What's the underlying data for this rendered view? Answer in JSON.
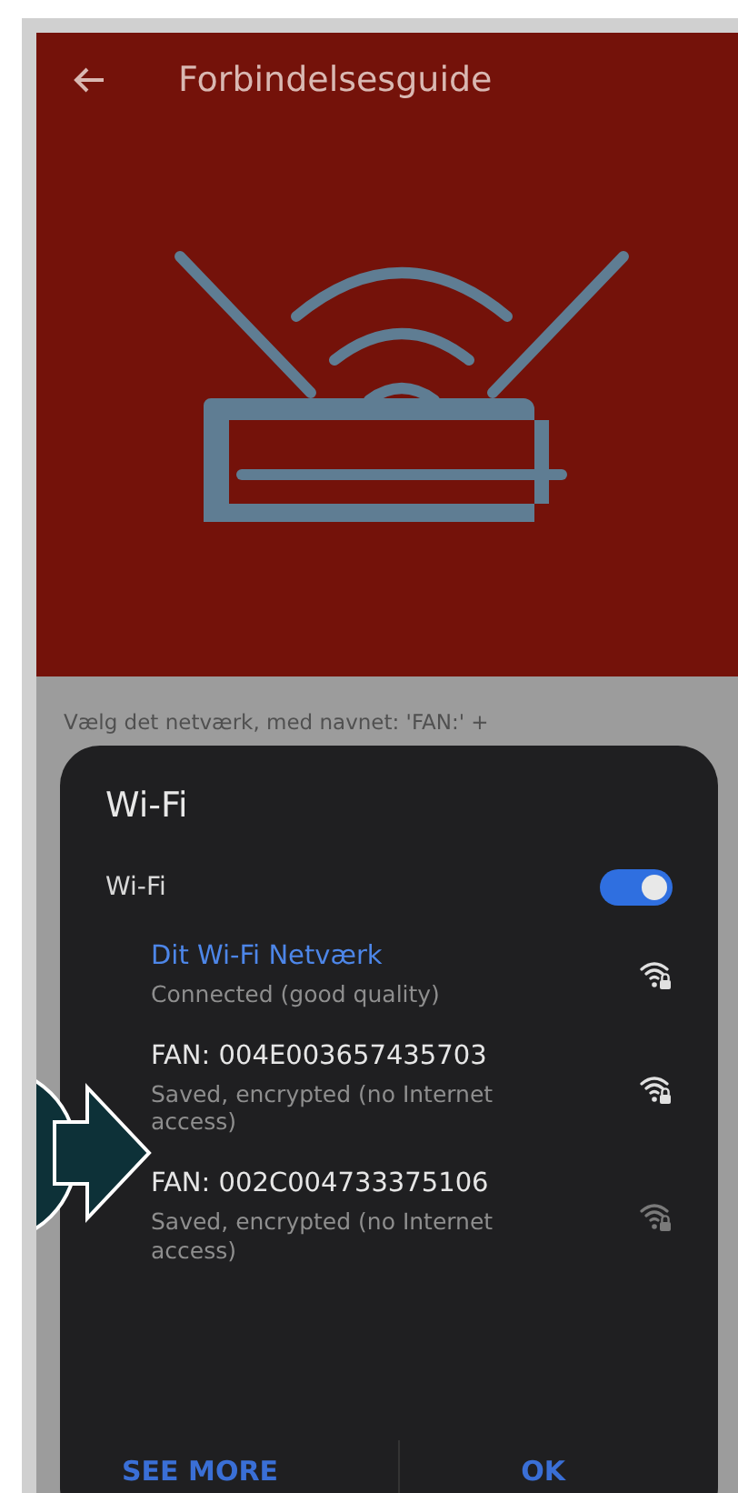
{
  "app_bar": {
    "title": "Forbindelsesguide"
  },
  "instruction": "Vælg det netværk, med navnet: 'FAN:' +",
  "dialog": {
    "title": "Wi-Fi",
    "wifi_toggle": {
      "label": "Wi-Fi",
      "on": true
    },
    "networks": [
      {
        "name": "Dit Wi-Fi Netværk",
        "status": "Connected (good quality)",
        "selected": true,
        "dimmed": false
      },
      {
        "name": "FAN: 004E003657435703",
        "status": "Saved, encrypted (no Internet access)",
        "selected": false,
        "dimmed": false
      },
      {
        "name": "FAN: 002C004733375106",
        "status": "Saved, encrypted (no Internet access)",
        "selected": false,
        "dimmed": true
      }
    ],
    "buttons": [
      "SEE MORE",
      "OK"
    ]
  }
}
